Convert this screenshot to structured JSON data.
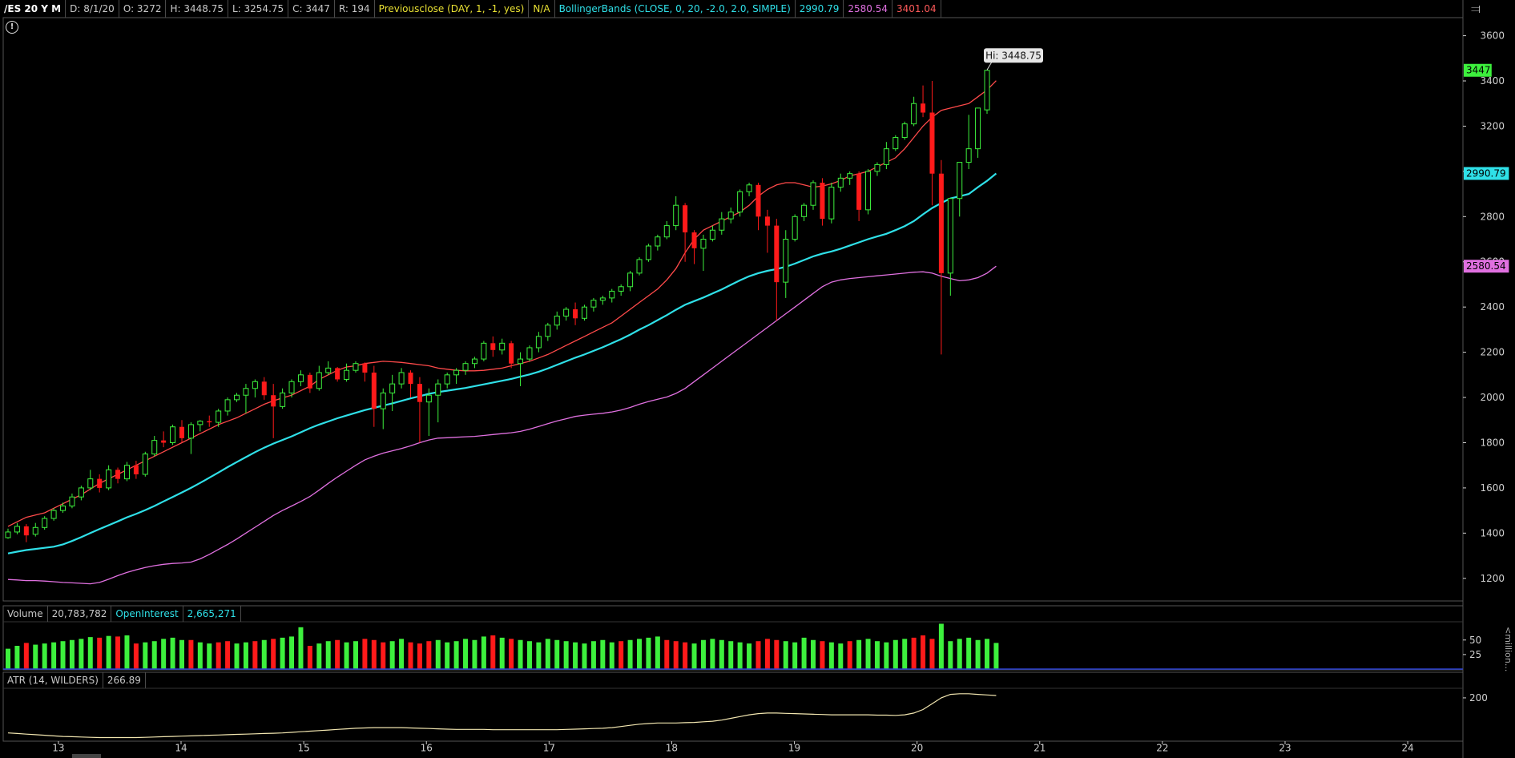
{
  "header": {
    "symbol": "/ES 20 Y M",
    "date": "D: 8/1/20",
    "open": "O: 3272",
    "high": "H: 3448.75",
    "low": "L: 3254.75",
    "close": "C: 3447",
    "range": "R: 194",
    "prevclose_label": "Previousclose (DAY, 1, -1, yes)",
    "prevclose_value": "N/A",
    "bb_label": "BollingerBands (CLOSE, 0, 20, -2.0, 2.0, SIMPLE)",
    "bb_mid": "2990.79",
    "bb_lower": "2580.54",
    "bb_upper": "3401.04"
  },
  "volume_header": {
    "label": "Volume",
    "value": "20,783,782",
    "oi_label": "OpenInterest",
    "oi_value": "2,665,271"
  },
  "atr_header": {
    "label": "ATR (14, WILDERS)",
    "value": "266.89"
  },
  "volume_axis_unit": "<million...",
  "hi_callout": "Hi: 3448.75",
  "colors": {
    "up": "#3df03d",
    "down": "#ff1a1a",
    "mid_band": "#2fe0e8",
    "upper_band": "#ff4a4a",
    "lower_band": "#e070e0",
    "atr": "#f2e6b0",
    "axis_text": "#cfcfcf",
    "border": "#555555"
  },
  "chart_data": {
    "type": "candlestick",
    "y_ticks": [
      1200,
      1400,
      1600,
      1800,
      2000,
      2200,
      2400,
      2600,
      2800,
      3000,
      3200,
      3400,
      3600
    ],
    "y_tick_labels": [
      "1200",
      "1400",
      "1600",
      "1800",
      "2000",
      "2200",
      "2400",
      "2600",
      "2800",
      "",
      "3200",
      "3400",
      "3600"
    ],
    "ylim": [
      1100,
      3680
    ],
    "x_labels": [
      "13",
      "14",
      "15",
      "16",
      "17",
      "18",
      "19",
      "20",
      "21",
      "22",
      "23",
      "24"
    ],
    "x_range": [
      12.55,
      24.45
    ],
    "price_markers": [
      {
        "label": "3447",
        "value": 3447,
        "color": "#3df03d"
      },
      {
        "label": "2990.79",
        "value": 2990.79,
        "color": "#2fe0e8"
      },
      {
        "label": "2580.54",
        "value": 2580.54,
        "color": "#e070e0"
      }
    ],
    "candles": [
      [
        1380,
        1420,
        1375,
        1405
      ],
      [
        1405,
        1445,
        1395,
        1430
      ],
      [
        1430,
        1440,
        1360,
        1390
      ],
      [
        1395,
        1445,
        1385,
        1425
      ],
      [
        1425,
        1475,
        1415,
        1465
      ],
      [
        1465,
        1510,
        1455,
        1500
      ],
      [
        1500,
        1535,
        1490,
        1520
      ],
      [
        1520,
        1575,
        1510,
        1560
      ],
      [
        1560,
        1610,
        1545,
        1600
      ],
      [
        1600,
        1680,
        1590,
        1640
      ],
      [
        1640,
        1660,
        1580,
        1600
      ],
      [
        1600,
        1700,
        1590,
        1680
      ],
      [
        1680,
        1690,
        1620,
        1640
      ],
      [
        1640,
        1715,
        1630,
        1700
      ],
      [
        1700,
        1720,
        1640,
        1660
      ],
      [
        1660,
        1760,
        1650,
        1750
      ],
      [
        1750,
        1830,
        1740,
        1810
      ],
      [
        1810,
        1850,
        1780,
        1800
      ],
      [
        1800,
        1880,
        1790,
        1870
      ],
      [
        1870,
        1900,
        1800,
        1820
      ],
      [
        1820,
        1890,
        1750,
        1880
      ],
      [
        1880,
        1900,
        1850,
        1895
      ],
      [
        1895,
        1920,
        1870,
        1890
      ],
      [
        1890,
        1950,
        1870,
        1940
      ],
      [
        1940,
        2000,
        1920,
        1990
      ],
      [
        1990,
        2020,
        1980,
        2010
      ],
      [
        2010,
        2060,
        1930,
        2040
      ],
      [
        2040,
        2080,
        2000,
        2070
      ],
      [
        2070,
        2090,
        1990,
        2010
      ],
      [
        2010,
        2060,
        1820,
        1960
      ],
      [
        1960,
        2040,
        1950,
        2020
      ],
      [
        2020,
        2080,
        2000,
        2070
      ],
      [
        2070,
        2120,
        2050,
        2100
      ],
      [
        2100,
        2110,
        2020,
        2040
      ],
      [
        2040,
        2140,
        2030,
        2110
      ],
      [
        2110,
        2160,
        2100,
        2130
      ],
      [
        2130,
        2135,
        2070,
        2080
      ],
      [
        2080,
        2150,
        2070,
        2120
      ],
      [
        2120,
        2160,
        2110,
        2150
      ],
      [
        2150,
        2155,
        2070,
        2110
      ],
      [
        2110,
        2140,
        1870,
        1950
      ],
      [
        1950,
        2040,
        1860,
        2020
      ],
      [
        2020,
        2100,
        1940,
        2060
      ],
      [
        2060,
        2130,
        2040,
        2110
      ],
      [
        2110,
        2120,
        2000,
        2060
      ],
      [
        2060,
        2090,
        1800,
        1980
      ],
      [
        1980,
        2040,
        1830,
        2010
      ],
      [
        2010,
        2080,
        1890,
        2060
      ],
      [
        2060,
        2110,
        2040,
        2100
      ],
      [
        2100,
        2130,
        2060,
        2120
      ],
      [
        2120,
        2160,
        2100,
        2150
      ],
      [
        2150,
        2180,
        2130,
        2170
      ],
      [
        2170,
        2250,
        2160,
        2240
      ],
      [
        2240,
        2270,
        2180,
        2210
      ],
      [
        2210,
        2260,
        2190,
        2240
      ],
      [
        2240,
        2250,
        2130,
        2150
      ],
      [
        2150,
        2200,
        2050,
        2170
      ],
      [
        2170,
        2230,
        2160,
        2220
      ],
      [
        2220,
        2290,
        2200,
        2270
      ],
      [
        2270,
        2330,
        2250,
        2320
      ],
      [
        2320,
        2380,
        2300,
        2360
      ],
      [
        2360,
        2400,
        2340,
        2390
      ],
      [
        2390,
        2420,
        2320,
        2350
      ],
      [
        2350,
        2410,
        2340,
        2400
      ],
      [
        2400,
        2440,
        2380,
        2430
      ],
      [
        2430,
        2450,
        2410,
        2440
      ],
      [
        2440,
        2480,
        2420,
        2470
      ],
      [
        2470,
        2500,
        2450,
        2490
      ],
      [
        2490,
        2560,
        2470,
        2550
      ],
      [
        2550,
        2620,
        2540,
        2610
      ],
      [
        2610,
        2680,
        2600,
        2670
      ],
      [
        2670,
        2720,
        2650,
        2710
      ],
      [
        2710,
        2780,
        2700,
        2760
      ],
      [
        2760,
        2890,
        2740,
        2850
      ],
      [
        2850,
        2860,
        2600,
        2730
      ],
      [
        2730,
        2740,
        2590,
        2660
      ],
      [
        2660,
        2720,
        2560,
        2700
      ],
      [
        2700,
        2760,
        2690,
        2740
      ],
      [
        2740,
        2820,
        2720,
        2790
      ],
      [
        2790,
        2840,
        2770,
        2820
      ],
      [
        2820,
        2920,
        2800,
        2910
      ],
      [
        2910,
        2950,
        2890,
        2940
      ],
      [
        2940,
        2950,
        2740,
        2800
      ],
      [
        2800,
        2830,
        2640,
        2760
      ],
      [
        2760,
        2790,
        2340,
        2510
      ],
      [
        2510,
        2740,
        2440,
        2700
      ],
      [
        2700,
        2810,
        2690,
        2800
      ],
      [
        2800,
        2860,
        2780,
        2850
      ],
      [
        2850,
        2960,
        2830,
        2950
      ],
      [
        2950,
        2970,
        2760,
        2790
      ],
      [
        2790,
        2950,
        2770,
        2930
      ],
      [
        2930,
        2990,
        2910,
        2970
      ],
      [
        2970,
        3000,
        2940,
        2990
      ],
      [
        2990,
        3000,
        2780,
        2830
      ],
      [
        2830,
        3010,
        2810,
        3000
      ],
      [
        3000,
        3040,
        2980,
        3030
      ],
      [
        3030,
        3130,
        3010,
        3100
      ],
      [
        3100,
        3160,
        3090,
        3150
      ],
      [
        3150,
        3220,
        3140,
        3210
      ],
      [
        3210,
        3330,
        3200,
        3300
      ],
      [
        3300,
        3380,
        3240,
        3260
      ],
      [
        3260,
        3400,
        2850,
        2990
      ],
      [
        2990,
        3050,
        2190,
        2550
      ],
      [
        2550,
        2880,
        2450,
        2880
      ],
      [
        2880,
        3040,
        2800,
        3040
      ],
      [
        3040,
        3250,
        3010,
        3100
      ],
      [
        3100,
        3230,
        3060,
        3280
      ],
      [
        3272,
        3448.75,
        3254.75,
        3447
      ]
    ],
    "bb_mid": [
      1310,
      1318,
      1325,
      1330,
      1335,
      1340,
      1350,
      1365,
      1382,
      1400,
      1418,
      1435,
      1452,
      1470,
      1485,
      1502,
      1520,
      1540,
      1560,
      1580,
      1600,
      1622,
      1645,
      1668,
      1692,
      1714,
      1736,
      1758,
      1778,
      1796,
      1812,
      1828,
      1846,
      1864,
      1880,
      1894,
      1908,
      1920,
      1932,
      1944,
      1954,
      1964,
      1974,
      1985,
      1996,
      2006,
      2016,
      2024,
      2030,
      2036,
      2042,
      2050,
      2058,
      2066,
      2074,
      2082,
      2092,
      2102,
      2114,
      2128,
      2144,
      2160,
      2176,
      2190,
      2206,
      2222,
      2240,
      2258,
      2278,
      2300,
      2320,
      2342,
      2364,
      2388,
      2410,
      2426,
      2442,
      2460,
      2478,
      2498,
      2518,
      2536,
      2550,
      2560,
      2568,
      2578,
      2592,
      2608,
      2624,
      2636,
      2646,
      2658,
      2672,
      2686,
      2700,
      2712,
      2724,
      2740,
      2758,
      2780,
      2810,
      2838,
      2860,
      2880,
      2890,
      2900,
      2930,
      2958,
      2990.79
    ],
    "bb_upper": [
      1430,
      1450,
      1470,
      1480,
      1490,
      1510,
      1530,
      1550,
      1570,
      1595,
      1620,
      1640,
      1660,
      1680,
      1700,
      1720,
      1740,
      1760,
      1780,
      1800,
      1820,
      1840,
      1860,
      1880,
      1895,
      1910,
      1930,
      1950,
      1970,
      1985,
      1998,
      2010,
      2030,
      2050,
      2080,
      2100,
      2120,
      2135,
      2140,
      2150,
      2155,
      2160,
      2158,
      2155,
      2150,
      2145,
      2140,
      2130,
      2125,
      2120,
      2118,
      2118,
      2120,
      2125,
      2130,
      2140,
      2150,
      2160,
      2175,
      2190,
      2210,
      2230,
      2250,
      2270,
      2290,
      2310,
      2330,
      2360,
      2390,
      2420,
      2450,
      2480,
      2520,
      2570,
      2640,
      2700,
      2740,
      2760,
      2780,
      2800,
      2820,
      2850,
      2890,
      2920,
      2940,
      2950,
      2950,
      2940,
      2930,
      2935,
      2945,
      2960,
      2980,
      2990,
      3000,
      3020,
      3040,
      3060,
      3100,
      3150,
      3200,
      3240,
      3270,
      3280,
      3290,
      3300,
      3330,
      3360,
      3401.04
    ],
    "bb_lower": [
      1195,
      1193,
      1190,
      1190,
      1188,
      1185,
      1182,
      1180,
      1178,
      1176,
      1182,
      1196,
      1212,
      1226,
      1238,
      1248,
      1256,
      1262,
      1266,
      1268,
      1272,
      1286,
      1306,
      1328,
      1350,
      1374,
      1400,
      1426,
      1452,
      1478,
      1500,
      1520,
      1540,
      1562,
      1590,
      1620,
      1648,
      1674,
      1700,
      1724,
      1740,
      1754,
      1764,
      1774,
      1786,
      1800,
      1812,
      1820,
      1822,
      1824,
      1826,
      1828,
      1832,
      1836,
      1840,
      1844,
      1850,
      1860,
      1872,
      1884,
      1896,
      1906,
      1916,
      1922,
      1926,
      1930,
      1936,
      1944,
      1956,
      1970,
      1982,
      1992,
      2002,
      2018,
      2040,
      2070,
      2100,
      2130,
      2160,
      2190,
      2220,
      2250,
      2280,
      2310,
      2340,
      2370,
      2400,
      2430,
      2460,
      2490,
      2510,
      2520,
      2526,
      2530,
      2534,
      2538,
      2542,
      2546,
      2550,
      2554,
      2556,
      2550,
      2536,
      2526,
      2516,
      2520,
      2530,
      2550,
      2580.54
    ],
    "volume_ticks": [
      25,
      50
    ],
    "volume_ylim": [
      0,
      80
    ],
    "volume": [
      35,
      40,
      45,
      42,
      44,
      46,
      48,
      50,
      52,
      55,
      54,
      57,
      56,
      58,
      44,
      46,
      48,
      52,
      54,
      50,
      50,
      46,
      44,
      46,
      48,
      44,
      46,
      48,
      50,
      52,
      54,
      56,
      72,
      40,
      44,
      48,
      50,
      46,
      48,
      52,
      50,
      46,
      48,
      52,
      46,
      44,
      48,
      50,
      46,
      48,
      52,
      50,
      56,
      58,
      54,
      52,
      50,
      48,
      46,
      52,
      50,
      48,
      46,
      44,
      48,
      50,
      46,
      48,
      50,
      52,
      54,
      56,
      50,
      48,
      46,
      44,
      50,
      52,
      50,
      48,
      46,
      44,
      48,
      52,
      50,
      48,
      46,
      54,
      50,
      48,
      46,
      44,
      48,
      50,
      52,
      48,
      46,
      50,
      52,
      54,
      58,
      52,
      78,
      48,
      52,
      54,
      50,
      52,
      45
    ],
    "volume_down": [
      2,
      10,
      12,
      14,
      20,
      23,
      24,
      27,
      29,
      33,
      36,
      39,
      40,
      41,
      44,
      45,
      46,
      53,
      55,
      67,
      72,
      73,
      74,
      82,
      83,
      84,
      89,
      92,
      99,
      100,
      101
    ],
    "atr": [
      80,
      78,
      76,
      74,
      72,
      70,
      68,
      67,
      66,
      65,
      64,
      64,
      64,
      64,
      64,
      65,
      66,
      67,
      68,
      69,
      70,
      71,
      72,
      73,
      74,
      75,
      76,
      77,
      78,
      79,
      80,
      82,
      84,
      86,
      88,
      90,
      92,
      94,
      96,
      97,
      98,
      98,
      98,
      98,
      97,
      96,
      95,
      94,
      93,
      92,
      92,
      92,
      92,
      91,
      91,
      91,
      91,
      91,
      91,
      91,
      91,
      92,
      93,
      94,
      95,
      96,
      98,
      102,
      106,
      110,
      112,
      114,
      114,
      114,
      115,
      116,
      118,
      120,
      124,
      130,
      136,
      142,
      146,
      148,
      148,
      147,
      146,
      145,
      144,
      143,
      142,
      142,
      142,
      142,
      142,
      141,
      141,
      140,
      142,
      148,
      160,
      180,
      200,
      212,
      214,
      214,
      212,
      210,
      208
    ],
    "atr_ticks": [
      200
    ],
    "atr_ylim": [
      60,
      230
    ]
  }
}
